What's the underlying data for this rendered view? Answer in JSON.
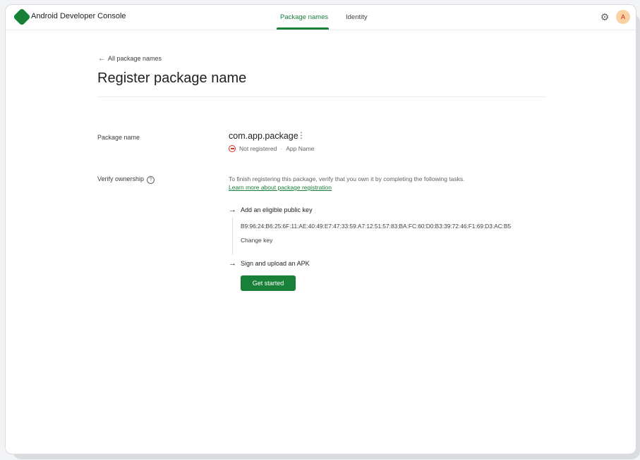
{
  "app": {
    "title": "Android Developer Console"
  },
  "nav": {
    "tabs": [
      {
        "label": "Package names",
        "active": true
      },
      {
        "label": "Identity",
        "active": false
      }
    ]
  },
  "header": {
    "settings_icon": "settings-gear-icon",
    "avatar_initial": "A"
  },
  "page": {
    "back_link": "All package names",
    "title": "Register package name"
  },
  "package": {
    "label": "Package name",
    "name": "com.app.package",
    "status": "Not registered",
    "app_name": "App Name"
  },
  "verify": {
    "label": "Verify ownership",
    "instructions": "To finish registering this package, verify that you own it by completing the following tasks.",
    "learn_more": "Learn more about package registration",
    "tasks": [
      {
        "label": "Add an eligible public key",
        "fingerprint": "B9:96:24:B6:25:6F:11:AE:40:49:E7:47:33:59:A7:12:51:57:83:BA:FC:60:D0:B3:39:72:46:F1:69:D3:AC:B5",
        "action": "Change key"
      },
      {
        "label": "Sign and upload an APK",
        "button": "Get started"
      }
    ]
  },
  "colors": {
    "accent": "#188038",
    "error": "#d93025",
    "avatar_bg": "#fad2a2"
  }
}
